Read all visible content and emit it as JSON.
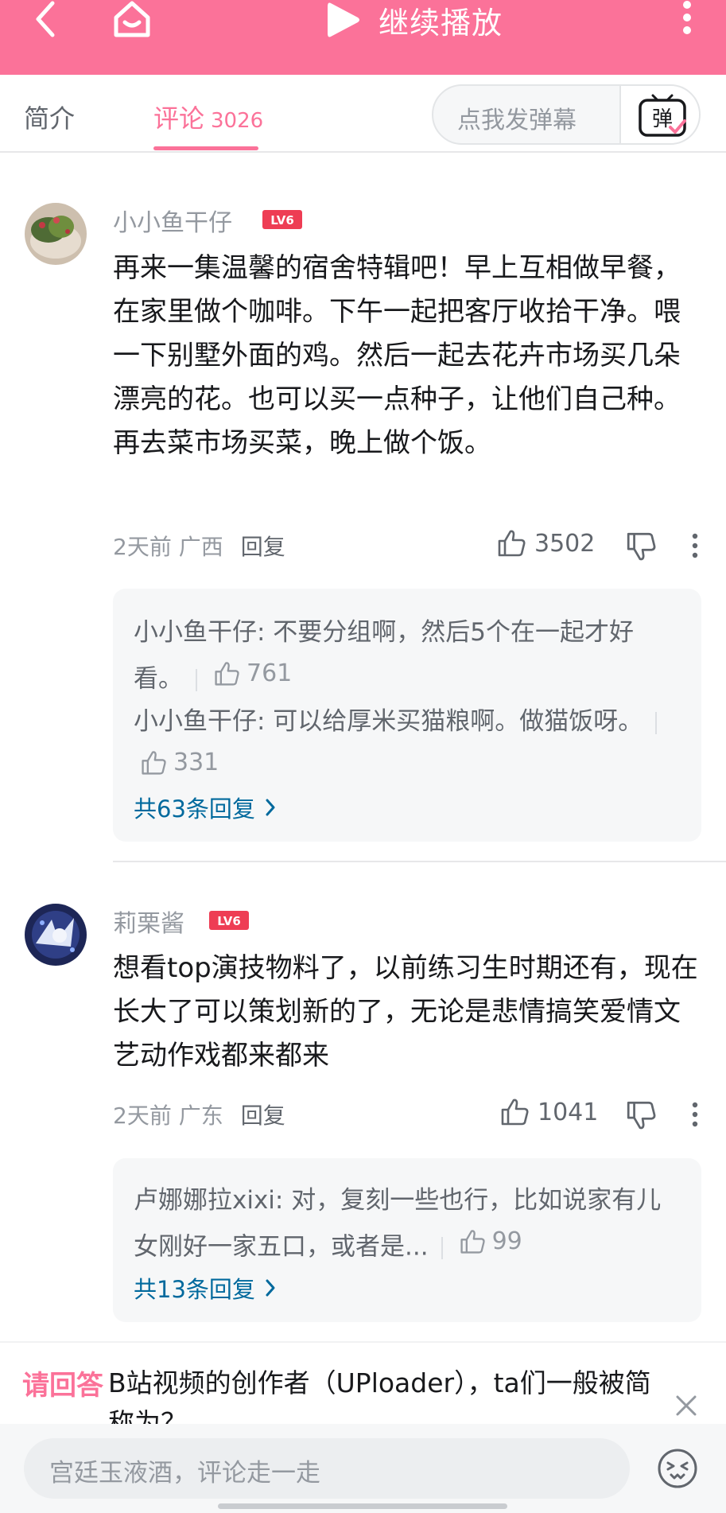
{
  "header": {
    "play_label": "继续播放",
    "accent_color": "#fb7299",
    "icons": [
      "back-icon",
      "home-icon",
      "play-icon",
      "more-icon"
    ]
  },
  "tabs": {
    "intro": "简介",
    "comments": "评论",
    "comment_count": "3026",
    "danmaku_placeholder": "点我发弹幕",
    "danmaku_button": "弹"
  },
  "comments": [
    {
      "user": "小小鱼干仔",
      "level": "LV6",
      "content": "再来一集温馨的宿舍特辑吧！早上互相做早餐，在家里做个咖啡。下午一起把客厅收拾干净。喂一下别墅外面的鸡。然后一起去花卉市场买几朵漂亮的花。也可以买一点种子，让他们自己种。再去菜市场买菜，晚上做个饭。",
      "time": "2天前",
      "location": "广西",
      "reply_label": "回复",
      "likes": "3502",
      "sub_replies": [
        {
          "text": "小小鱼干仔: 不要分组啊，然后5个在一起才好看。",
          "likes": "761"
        },
        {
          "text": "小小鱼干仔: 可以给厚米买猫粮啊。做猫饭呀。",
          "likes": "331"
        }
      ],
      "more_replies": "共63条回复"
    },
    {
      "user": "莉栗酱",
      "level": "LV6",
      "content": "想看top演技物料了，以前练习生时期还有，现在长大了可以策划新的了，无论是悲情搞笑爱情文艺动作戏都来都来",
      "time": "2天前",
      "location": "广东",
      "reply_label": "回复",
      "likes": "1041",
      "sub_replies": [
        {
          "text": "卢娜娜拉xixi: 对，复刻一些也行，比如说家有儿女刚好一家五口，或者是...",
          "likes": "99"
        }
      ],
      "more_replies": "共13条回复"
    }
  ],
  "question": {
    "tag": "请回答",
    "text": "B站视频的创作者（UPloader），ta们一般被简称为？"
  },
  "bottom": {
    "placeholder": "宫廷玉液酒，评论走一走"
  }
}
